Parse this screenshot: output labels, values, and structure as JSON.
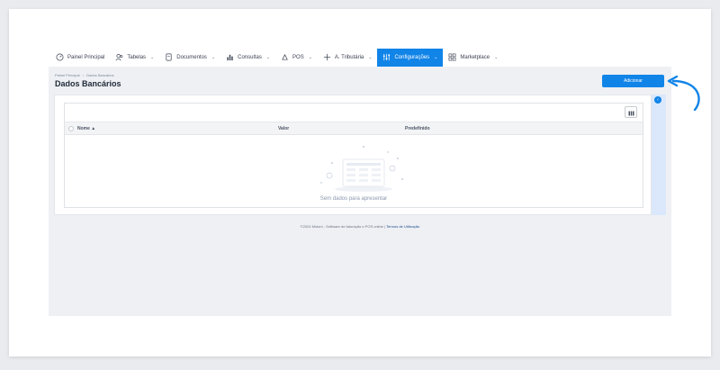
{
  "nav": {
    "items": [
      {
        "label": "Painel Principal",
        "icon": "dashboard-icon",
        "has_dropdown": false
      },
      {
        "label": "Tabelas",
        "icon": "users-icon",
        "has_dropdown": true
      },
      {
        "label": "Documentos",
        "icon": "document-icon",
        "has_dropdown": true
      },
      {
        "label": "Consultas",
        "icon": "chart-icon",
        "has_dropdown": true
      },
      {
        "label": "POS",
        "icon": "pos-icon",
        "has_dropdown": true
      },
      {
        "label": "A. Tributária",
        "icon": "tax-icon",
        "has_dropdown": true
      },
      {
        "label": "Configurações",
        "icon": "settings-icon",
        "has_dropdown": true,
        "active": true
      },
      {
        "label": "Marketplace",
        "icon": "marketplace-icon",
        "has_dropdown": true
      }
    ],
    "active_color": "#1184e8"
  },
  "breadcrumb": [
    "Painel Principal",
    "›",
    "Dados Bancários"
  ],
  "page": {
    "title": "Dados Bancários",
    "add_button": "Adicionar"
  },
  "table": {
    "columns": [
      "Nome ▲",
      "Valor",
      "Predefinido"
    ],
    "empty_message": "Sem dados para apresentar"
  },
  "footer": {
    "text": "©2024 Moloni - Software de faturação e POS online |",
    "link": "Termos de Utilização"
  },
  "colors": {
    "primary": "#1184e8",
    "annotation_arrow": "#1184e8"
  }
}
